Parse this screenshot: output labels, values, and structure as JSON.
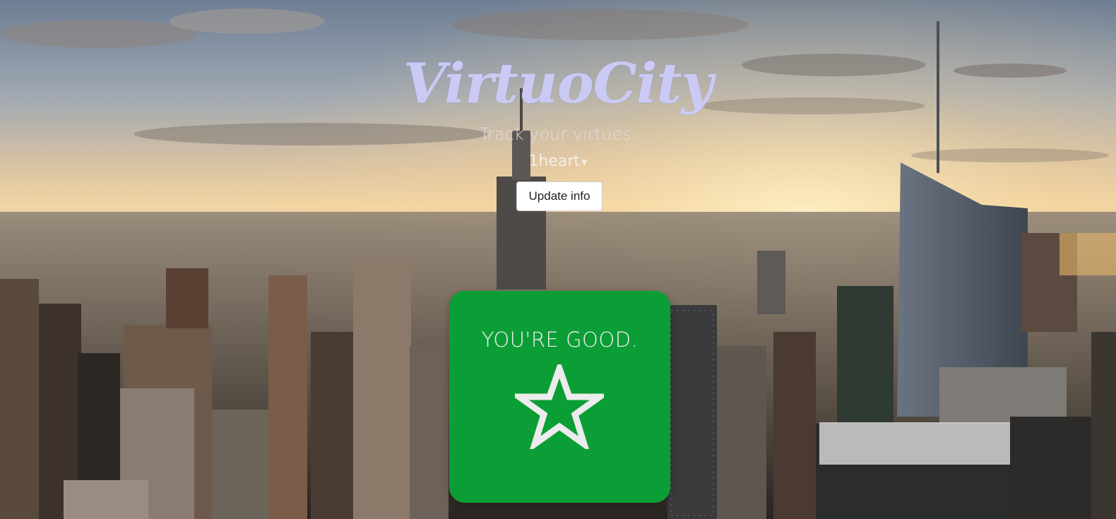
{
  "header": {
    "title": "VirtuoCity",
    "tagline": "Track your virtues.",
    "virtue_select": {
      "value": "1heart",
      "caret_icon": "triangle-down-icon"
    },
    "update_button_label": "Update info"
  },
  "status_card": {
    "message": "YOU'RE GOOD.",
    "icon": "star-outline-icon",
    "color": "#0c9e36"
  },
  "colors": {
    "title": "#cbcaf5",
    "button_bg": "#ffffff",
    "status_green": "#0c9e36"
  }
}
